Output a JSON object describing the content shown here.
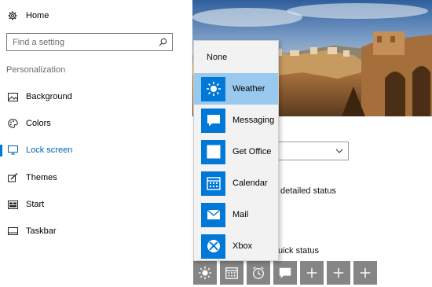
{
  "sidebar": {
    "home_label": "Home",
    "search_placeholder": "Find a setting",
    "section_title": "Personalization",
    "items": [
      {
        "label": "Background",
        "icon": "picture-icon"
      },
      {
        "label": "Colors",
        "icon": "palette-icon"
      },
      {
        "label": "Lock screen",
        "icon": "monitor-icon",
        "active": true
      },
      {
        "label": "Themes",
        "icon": "brush-icon"
      },
      {
        "label": "Start",
        "icon": "start-icon"
      },
      {
        "label": "Taskbar",
        "icon": "taskbar-icon"
      }
    ]
  },
  "content": {
    "detailed_status_text": "detailed status",
    "quick_status_text": "uick status",
    "quick_status_slots": [
      {
        "icon": "weather-icon"
      },
      {
        "icon": "calendar-icon"
      },
      {
        "icon": "alarm-icon"
      },
      {
        "icon": "message-icon"
      },
      {
        "icon": "plus-icon"
      },
      {
        "icon": "plus-icon"
      },
      {
        "icon": "plus-icon"
      }
    ]
  },
  "app_flyout": {
    "options": [
      {
        "label": "None"
      },
      {
        "label": "Weather",
        "icon": "weather-icon",
        "selected": true
      },
      {
        "label": "Messaging",
        "icon": "message-icon"
      },
      {
        "label": "Get Office",
        "icon": "office-icon"
      },
      {
        "label": "Calendar",
        "icon": "calendar-icon"
      },
      {
        "label": "Mail",
        "icon": "mail-icon"
      },
      {
        "label": "Xbox",
        "icon": "xbox-icon"
      }
    ]
  },
  "colors": {
    "accent": "#0078d7",
    "selected_option": "#99c9ef",
    "slot_gray": "#858585"
  }
}
